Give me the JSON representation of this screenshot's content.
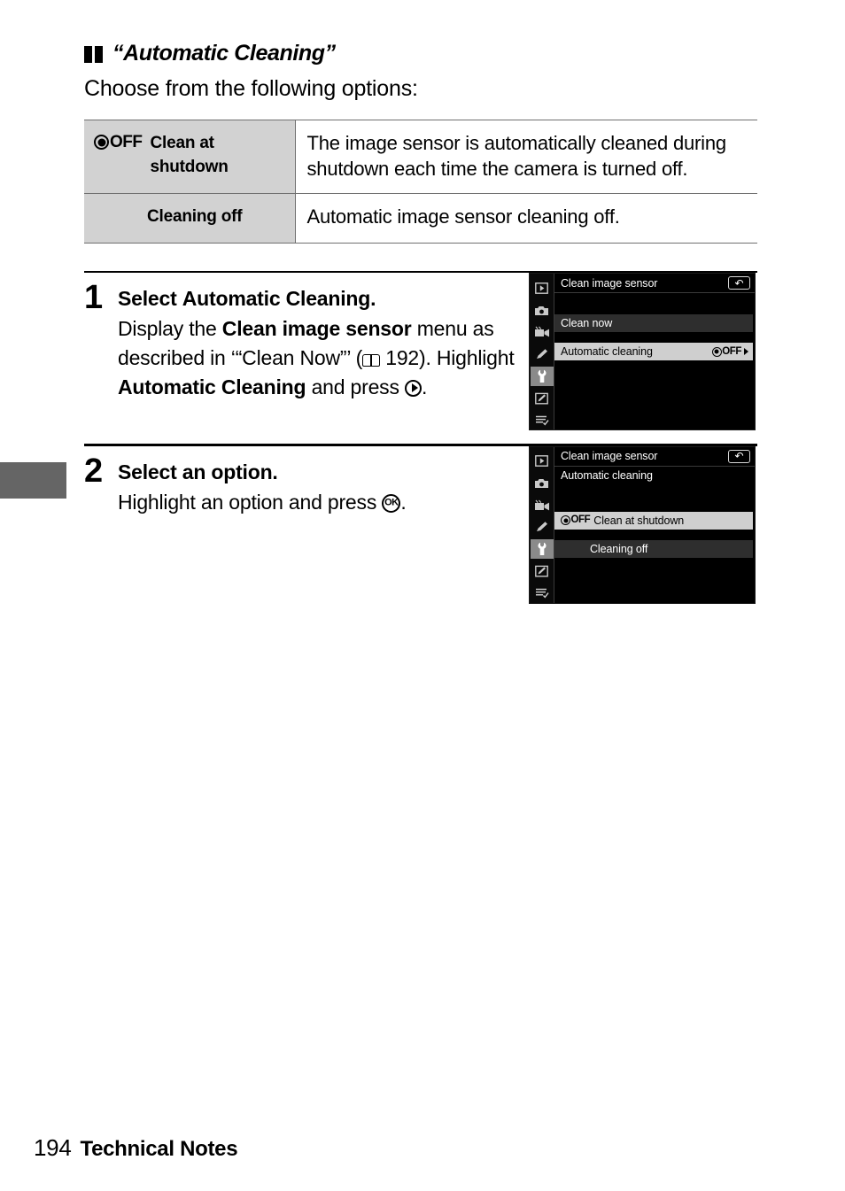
{
  "section": {
    "bullet_icon": "double-square-icon",
    "title": "“Automatic Cleaning”",
    "lead": "Choose from the following options:"
  },
  "options_table": {
    "rows": [
      {
        "icon": "clean-at-shutdown-icon",
        "icon_text": "OFF",
        "label": "Clean at shutdown",
        "description": "The image sensor is automatically cleaned during shutdown each time the camera is turned off."
      },
      {
        "icon": null,
        "icon_text": "",
        "label": "Cleaning off",
        "description": "Automatic image sensor cleaning off."
      }
    ]
  },
  "steps": [
    {
      "number": "1",
      "title_prefix": "Select ",
      "title_bold": "Automatic Cleaning",
      "title_suffix": ".",
      "body_parts": [
        {
          "text": "Display the ",
          "bold": false
        },
        {
          "text": "Clean image sensor",
          "bold": true
        },
        {
          "text": " menu as described in ‘“Clean Now”’ (",
          "bold": false
        },
        {
          "text": "book-icon",
          "icon": true
        },
        {
          "text": " 192). Highlight ",
          "bold": false
        },
        {
          "text": "Automatic Cleaning",
          "bold": true
        },
        {
          "text": " and press ",
          "bold": false
        },
        {
          "text": "multi-selector-right-icon",
          "icon": true
        },
        {
          "text": ".",
          "bold": false
        }
      ],
      "body_plain": "Display the Clean image sensor menu as described in ‘“Clean Now”’ ( 192). Highlight Automatic Cleaning and press ▶."
    },
    {
      "number": "2",
      "title_prefix": "Select an option.",
      "title_bold": "",
      "title_suffix": "",
      "body_plain": "Highlight an option and press OK."
    }
  ],
  "lcd_screens": [
    {
      "name": "clean-image-sensor-menu",
      "title": "Clean image sensor",
      "return_glyph": "↶",
      "subtitle": "",
      "sidebar_icons": [
        {
          "name": "playback-menu-icon",
          "glyph": "▶",
          "active": false
        },
        {
          "name": "photo-shooting-menu-icon",
          "glyph": "■",
          "active": false
        },
        {
          "name": "movie-shooting-menu-icon",
          "glyph": "▶",
          "active": false
        },
        {
          "name": "custom-settings-menu-icon",
          "glyph": "✎",
          "active": false
        },
        {
          "name": "setup-menu-icon",
          "glyph": "⚒",
          "active": true
        },
        {
          "name": "retouch-menu-icon",
          "glyph": "✎",
          "active": false
        },
        {
          "name": "my-menu-icon",
          "glyph": "≡",
          "active": false
        }
      ],
      "rows": [
        {
          "label": "Clean now",
          "style": "dim",
          "badge": "",
          "caret": false,
          "icon": false
        },
        {
          "label": "Automatic cleaning",
          "style": "sel",
          "badge": "OFF",
          "caret": true,
          "icon": false
        }
      ]
    },
    {
      "name": "automatic-cleaning-options",
      "title": "Clean image sensor",
      "return_glyph": "↶",
      "subtitle": "Automatic cleaning",
      "sidebar_icons": [
        {
          "name": "playback-menu-icon",
          "glyph": "▶",
          "active": false
        },
        {
          "name": "photo-shooting-menu-icon",
          "glyph": "■",
          "active": false
        },
        {
          "name": "movie-shooting-menu-icon",
          "glyph": "▶",
          "active": false
        },
        {
          "name": "custom-settings-menu-icon",
          "glyph": "✎",
          "active": false
        },
        {
          "name": "setup-menu-icon",
          "glyph": "⚒",
          "active": true
        },
        {
          "name": "retouch-menu-icon",
          "glyph": "✎",
          "active": false
        },
        {
          "name": "my-menu-icon",
          "glyph": "≡",
          "active": false
        }
      ],
      "rows": [
        {
          "label": "Clean at shutdown",
          "style": "sel",
          "badge": "",
          "caret": false,
          "icon": true
        },
        {
          "label": "Cleaning off",
          "style": "dim",
          "badge": "",
          "caret": false,
          "icon": false,
          "indent": true
        }
      ]
    }
  ],
  "footer": {
    "page_number": "194",
    "chapter": "Technical Notes"
  },
  "colors": {
    "table_label_bg": "#d2d2d2",
    "rule": "#6f6f6f",
    "chapter_tab": "#656565",
    "lcd_bg": "#000000",
    "lcd_row_dim": "#2e2e2e",
    "lcd_row_selected": "#cfcfcf"
  }
}
